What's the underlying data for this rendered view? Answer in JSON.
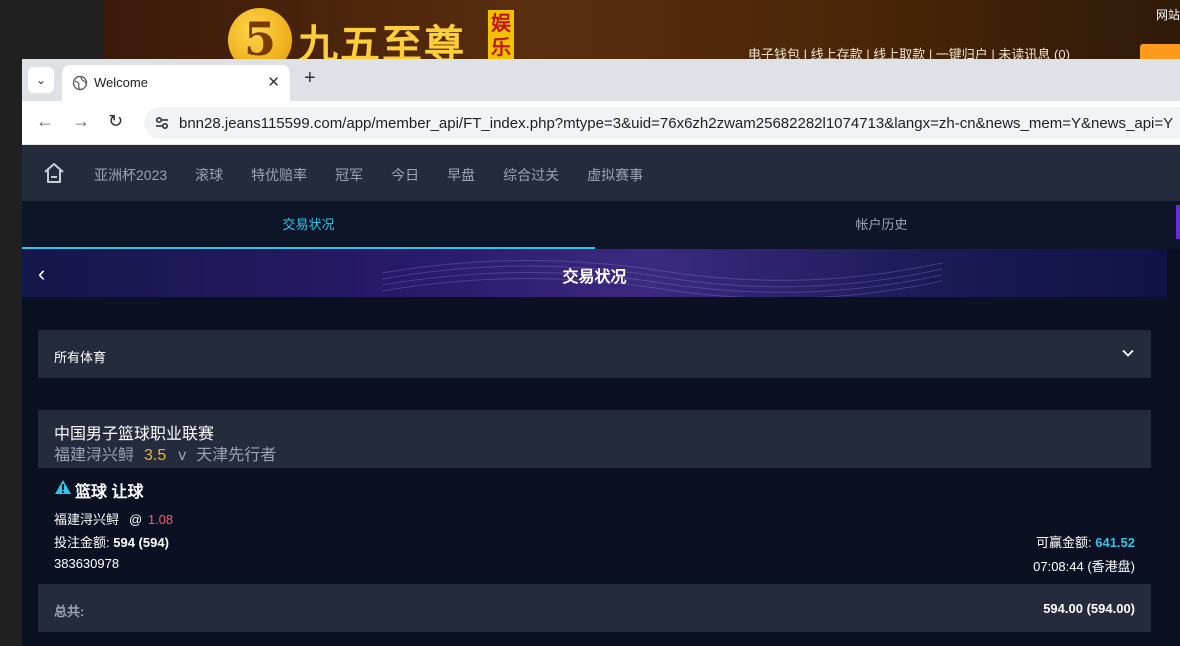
{
  "background_site": {
    "logo_digit": "5",
    "logo_text": "九五至尊",
    "logo_badge": "娱乐",
    "header_links": "电子钱包 | 线上存款 | 线上取款 | 一键归户 | 未读讯息 (0)",
    "corner_text": "网站"
  },
  "browser": {
    "tab_title": "Welcome",
    "url": "bnn28.jeans115599.com/app/member_api/FT_index.php?mtype=3&uid=76x6zh2zwam25682282l1074713&langx=zh-cn&news_mem=Y&news_api=Y"
  },
  "nav": {
    "items": [
      "亚洲杯2023",
      "滚球",
      "特优赔率",
      "冠军",
      "今日",
      "早盘",
      "综合过关",
      "虚拟赛事"
    ]
  },
  "subtabs": {
    "active": "交易状况",
    "inactive": "帐户历史"
  },
  "banner": {
    "title": "交易状况"
  },
  "filter": {
    "selected": "所有体育"
  },
  "bet": {
    "league": "中国男子篮球职业联赛",
    "home_team": "福建浔兴鲟",
    "handicap": "3.5",
    "vs": "v",
    "away_team": "天津先行者",
    "bet_type": "篮球 让球",
    "pick_team": "福建浔兴鲟",
    "at": "@",
    "odds": "1.08",
    "stake_label": "投注金额:",
    "stake_value": "594 (594)",
    "win_label": "可赢金额:",
    "win_value": "641.52",
    "ticket_id": "383630978",
    "time": "07:08:44 (香港盘)"
  },
  "total": {
    "label": "总共:",
    "value": "594.00 (594.00)"
  },
  "colors": {
    "accent": "#35c3e6",
    "handicap": "#f0b429",
    "odds": "#ff5a5a",
    "panel": "#242b3c",
    "page_bg": "#0b1122"
  }
}
